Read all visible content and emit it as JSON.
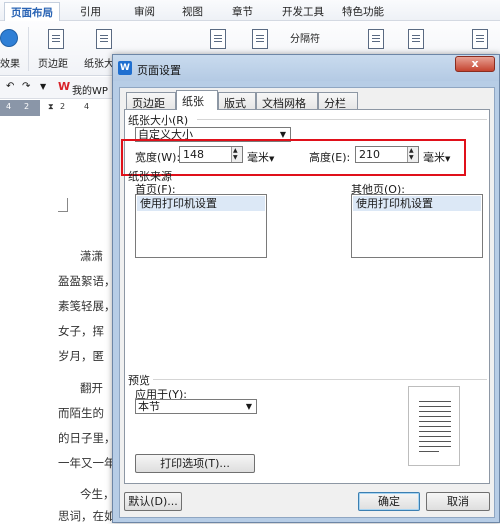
{
  "ribbon": {
    "tabs": [
      "页面布局",
      "引用",
      "审阅",
      "视图",
      "章节",
      "开发工具",
      "特色功能"
    ],
    "active_tab": "页面布局",
    "buttons": {
      "effects_label": "效果",
      "margins_label": "页边距",
      "paper_label": "纸张大",
      "separator_label": "分隔符"
    },
    "my_wps": "我的WP"
  },
  "ruler": {
    "numbers": [
      "4",
      "2",
      "2",
      "4"
    ]
  },
  "document": {
    "lines": [
      "潇潇",
      "盈盈絮语，",
      "素笺轻展，",
      "女子，挥",
      "岁月，匿",
      "翻开",
      "而陌生的",
      "的日子里，",
      "一年又一年",
      "今生，",
      "思词，在如"
    ]
  },
  "dialog": {
    "title": "页面设置",
    "close_label": "x",
    "tabs": [
      "页边距",
      "纸张",
      "版式",
      "文档网格",
      "分栏"
    ],
    "active_tab": "纸张",
    "paper_size": {
      "group_label": "纸张大小(R)",
      "selected": "自定义大小",
      "width_label": "宽度(W):",
      "width_value": "148",
      "width_unit": "毫米",
      "height_label": "高度(E):",
      "height_value": "210",
      "height_unit": "毫米"
    },
    "paper_source": {
      "group_label": "纸张来源",
      "first_page_label": "首页(F):",
      "first_page_item": "使用打印机设置",
      "other_pages_label": "其他页(O):",
      "other_pages_item": "使用打印机设置"
    },
    "preview": {
      "group_label": "预览",
      "apply_to_label": "应用于(Y):",
      "apply_to_value": "本节"
    },
    "print_options_button": "打印选项(T)...",
    "default_button": "默认(D)...",
    "ok_button": "确定",
    "cancel_button": "取消"
  },
  "colors": {
    "highlight_box": "#e0101a",
    "active_ribbon_tab": "#2a64b4",
    "close_button": "#c4432f"
  }
}
